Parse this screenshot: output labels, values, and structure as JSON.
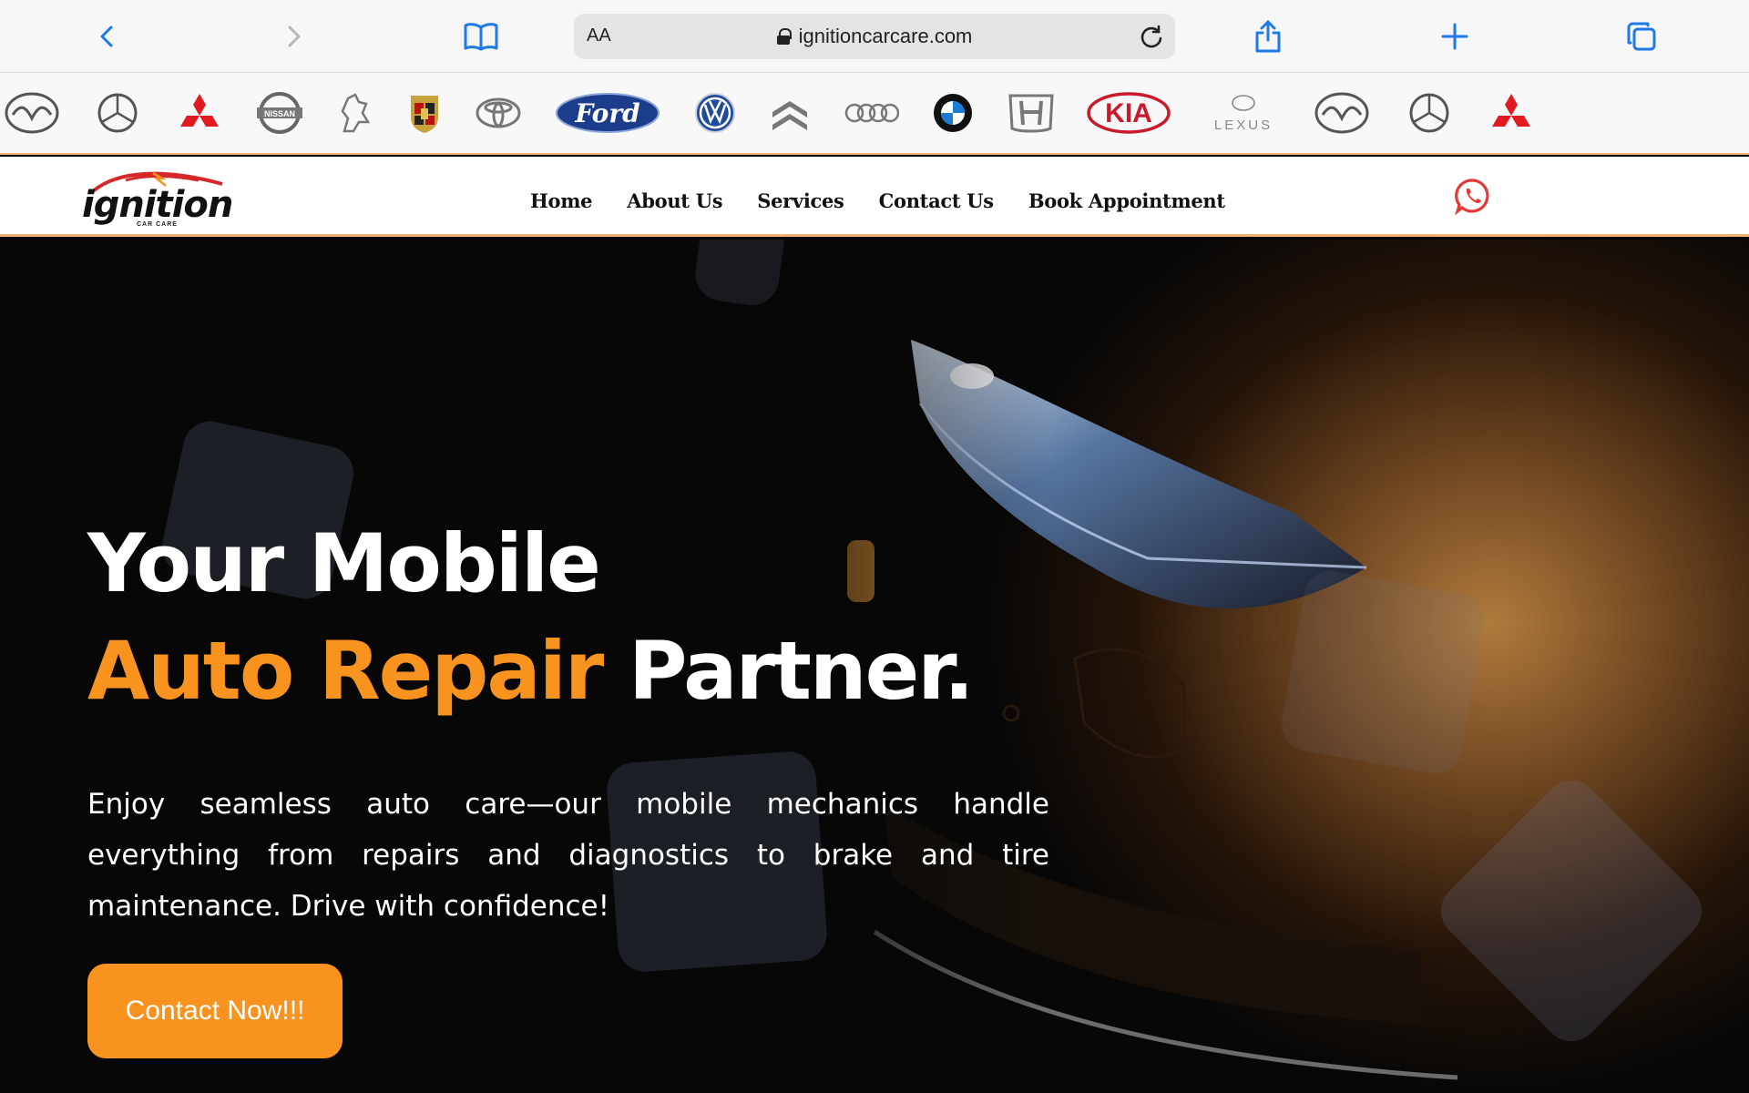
{
  "browser": {
    "url_size_label": "AA",
    "url": "ignitioncarcare.com",
    "icons": [
      "back-icon",
      "forward-icon",
      "reader-icon",
      "lock-icon",
      "reload-icon",
      "share-icon",
      "new-tab-icon",
      "tabs-icon"
    ]
  },
  "brands": [
    {
      "name": "Mazda",
      "icon": "mazda-logo"
    },
    {
      "name": "Mercedes-Benz",
      "icon": "mercedes-logo"
    },
    {
      "name": "Mitsubishi",
      "icon": "mitsubishi-logo"
    },
    {
      "name": "NISSAN",
      "icon": "nissan-logo"
    },
    {
      "name": "Peugeot",
      "icon": "peugeot-logo"
    },
    {
      "name": "Porsche",
      "icon": "porsche-logo"
    },
    {
      "name": "Toyota",
      "icon": "toyota-logo"
    },
    {
      "name": "Ford",
      "icon": "ford-logo"
    },
    {
      "name": "VW",
      "icon": "volkswagen-logo"
    },
    {
      "name": "Citroen",
      "icon": "citroen-logo"
    },
    {
      "name": "Audi",
      "icon": "audi-logo"
    },
    {
      "name": "BMW",
      "icon": "bmw-logo"
    },
    {
      "name": "Honda",
      "icon": "honda-logo"
    },
    {
      "name": "KIA",
      "icon": "kia-logo"
    },
    {
      "name": "LEXUS",
      "icon": "lexus-logo"
    }
  ],
  "site": {
    "logo_text": "ignition",
    "logo_sub": "CAR CARE",
    "nav": [
      "Home",
      "About Us",
      "Services",
      "Contact Us",
      "Book Appointment"
    ],
    "whatsapp_icon": "whatsapp-icon"
  },
  "hero": {
    "line1": "Your Mobile",
    "line2_accent": "Auto Repair",
    "line2_rest": "Partner.",
    "description": "Enjoy seamless auto care—our mobile mechanics handle everything from repairs and diagnostics to brake and tire maintenance. Drive with confidence!",
    "cta": "Contact Now!!!"
  },
  "colors": {
    "accent": "#f7931e",
    "safari_blue": "#1e7ae6",
    "whatsapp_red": "#e53935"
  }
}
